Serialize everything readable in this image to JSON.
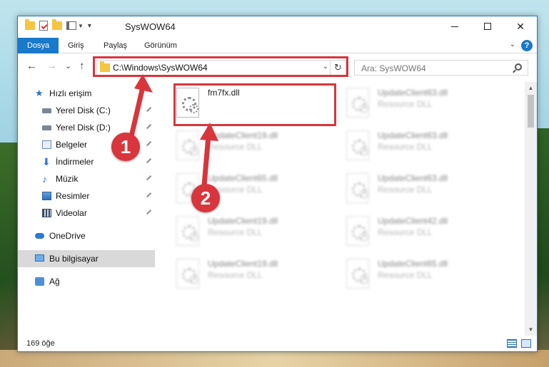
{
  "window": {
    "title": "SysWOW64",
    "controls": {
      "minimize": "—",
      "maximize": "",
      "close": "✕"
    }
  },
  "ribbon": {
    "tabs": [
      {
        "label": "Dosya",
        "active": true
      },
      {
        "label": "Giriş"
      },
      {
        "label": "Paylaş"
      },
      {
        "label": "Görünüm"
      }
    ],
    "help": "?"
  },
  "nav": {
    "back": "←",
    "forward": "→",
    "recent": "⌄",
    "up": "↑",
    "address": "C:\\Windows\\SysWOW64",
    "address_dropdown": "⌄",
    "refresh": "↻",
    "search_placeholder": "Ara: SysWOW64"
  },
  "sidebar": {
    "items": [
      {
        "label": "Hızlı erişim",
        "icon": "star-icon"
      },
      {
        "label": "Yerel Disk (C:)",
        "icon": "drive-icon",
        "pinned": true
      },
      {
        "label": "Yerel Disk (D:)",
        "icon": "drive-icon",
        "pinned": true
      },
      {
        "label": "Belgeler",
        "icon": "documents-icon",
        "pinned": true
      },
      {
        "label": "İndirmeler",
        "icon": "download-icon",
        "pinned": true
      },
      {
        "label": "Müzik",
        "icon": "music-icon",
        "pinned": true
      },
      {
        "label": "Resimler",
        "icon": "pictures-icon",
        "pinned": true
      },
      {
        "label": "Videolar",
        "icon": "videos-icon",
        "pinned": true
      },
      {
        "label": "OneDrive",
        "icon": "onedrive-icon"
      },
      {
        "label": "Bu bilgisayar",
        "icon": "this-pc-icon",
        "selected": true
      },
      {
        "label": "Ağ",
        "icon": "network-icon"
      }
    ]
  },
  "files": [
    {
      "name": "fm7fx.dll",
      "type": "",
      "highlighted": true
    },
    {
      "name": "UpdateClient63.dll",
      "type": "Resource DLL"
    },
    {
      "name": "UpdateClient19.dll",
      "type": "Resource DLL"
    },
    {
      "name": "UpdateClient63.dll",
      "type": "Resource DLL"
    },
    {
      "name": "UpdateClient65.dll",
      "type": "Resource DLL"
    },
    {
      "name": "UpdateClient63.dll",
      "type": "Resource DLL"
    },
    {
      "name": "UpdateClient19.dll",
      "type": "Resource DLL"
    },
    {
      "name": "UpdateClient42.dll",
      "type": "Resource DLL"
    },
    {
      "name": "UpdateClient19.dll",
      "type": "Resource DLL"
    },
    {
      "name": "UpdateClient65.dll",
      "type": "Resource DLL"
    }
  ],
  "status": {
    "count": "169 öğe"
  },
  "callouts": [
    {
      "number": "1"
    },
    {
      "number": "2"
    }
  ],
  "colors": {
    "accent": "#1979ca",
    "highlight": "#d9353c"
  }
}
